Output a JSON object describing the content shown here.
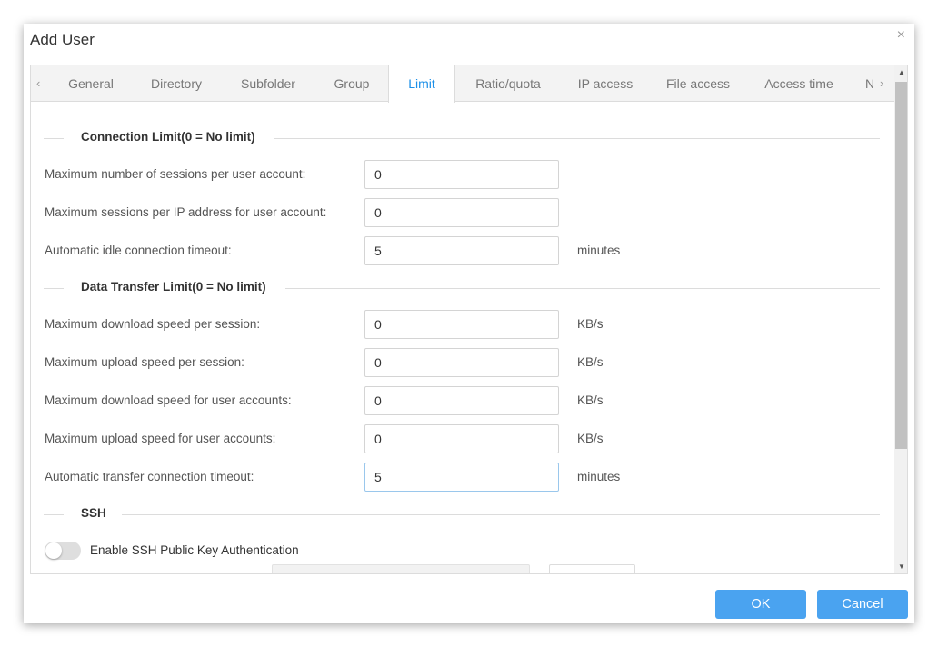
{
  "dialog": {
    "title": "Add User",
    "close_glyph": "×"
  },
  "tabs": [
    {
      "label": "General"
    },
    {
      "label": "Directory"
    },
    {
      "label": "Subfolder"
    },
    {
      "label": "Group"
    },
    {
      "label": "Limit",
      "active": true
    },
    {
      "label": "Ratio/quota"
    },
    {
      "label": "IP access"
    },
    {
      "label": "File access"
    },
    {
      "label": "Access time"
    },
    {
      "label": "N"
    }
  ],
  "tab_arrows": {
    "left": "‹",
    "right": "›"
  },
  "sections": {
    "connection": {
      "title": "Connection Limit(0 = No limit)",
      "rows": [
        {
          "label": "Maximum number of sessions per user account:",
          "value": "0",
          "unit": ""
        },
        {
          "label": "Maximum sessions per IP address for user account:",
          "value": "0",
          "unit": ""
        },
        {
          "label": "Automatic idle connection timeout:",
          "value": "5",
          "unit": "minutes"
        }
      ]
    },
    "transfer": {
      "title": "Data Transfer Limit(0 = No limit)",
      "rows": [
        {
          "label": "Maximum download speed per session:",
          "value": "0",
          "unit": "KB/s"
        },
        {
          "label": "Maximum upload speed per session:",
          "value": "0",
          "unit": "KB/s"
        },
        {
          "label": "Maximum download speed for user accounts:",
          "value": "0",
          "unit": "KB/s"
        },
        {
          "label": "Maximum upload speed for user accounts:",
          "value": "0",
          "unit": "KB/s"
        },
        {
          "label": "Automatic transfer connection timeout:",
          "value": "5",
          "unit": "minutes"
        }
      ]
    },
    "ssh": {
      "title": "SSH",
      "toggle_label": "Enable SSH Public Key Authentication",
      "toggle_on": false
    }
  },
  "buttons": {
    "ok": "OK",
    "cancel": "Cancel"
  },
  "colors": {
    "accent": "#1b8fe8",
    "button": "#4aa3f0"
  },
  "icons": {
    "close": "close-icon",
    "scroll_up": "scroll-up-arrow",
    "scroll_down": "scroll-down-arrow"
  }
}
